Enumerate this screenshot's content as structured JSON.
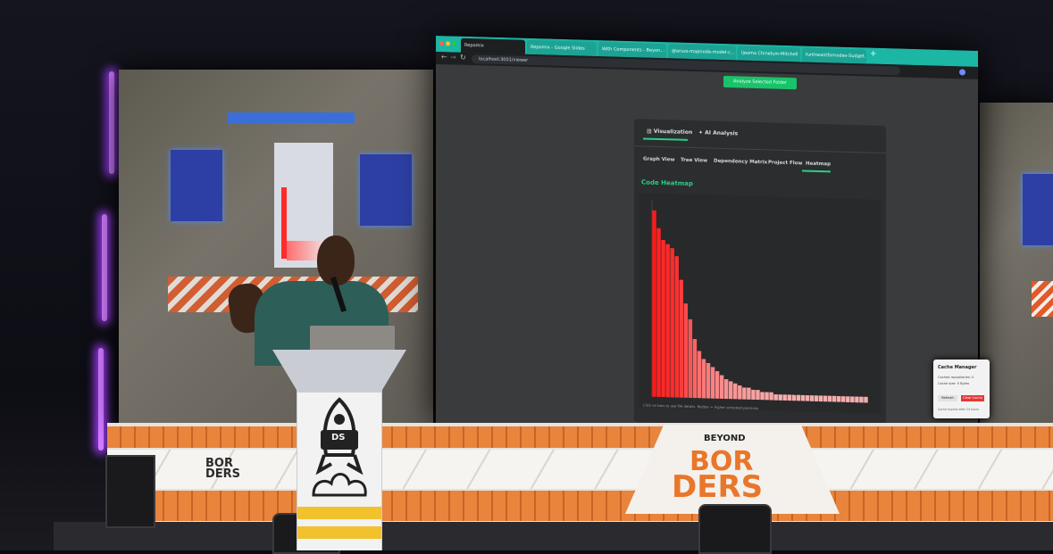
{
  "browser": {
    "tabs": [
      "Repomix",
      "Repomix - Google Slides",
      "With Components - Beyon…",
      "@aruss-mapnode-model-c…",
      "Ijeoma Chinelum-Mitchell",
      "furthwantfornodes-Sudget…"
    ],
    "url": "localhost:3001/viewer"
  },
  "app": {
    "analyze_button": "Analyze Selected Folder",
    "main_tabs": [
      "Visualization",
      "AI Analysis"
    ],
    "sub_tabs": [
      "Graph View",
      "Tree View",
      "Dependency Matrix",
      "Project Flow",
      "Heatmap"
    ],
    "heatmap_title": "Code Heatmap",
    "chart_note": "Click on bars to see file details. Redder = higher complexity/activity"
  },
  "cache_manager": {
    "title": "Cache Manager",
    "line1": "Cached repositories: 0",
    "line2": "Cache size: 0 Bytes",
    "refresh": "Refresh",
    "clear": "Clear Cache",
    "note": "Cache expires after 24 hours"
  },
  "stage": {
    "logo_top": "BEYOND",
    "logo_mid": "BOR",
    "logo_bot": "DERS",
    "podium_logo": "DS"
  },
  "chart_data": {
    "type": "bar",
    "values": [
      95,
      86,
      80,
      78,
      76,
      72,
      60,
      48,
      40,
      30,
      24,
      20,
      18,
      16,
      14,
      12,
      10,
      9,
      8,
      7,
      6,
      6,
      5,
      5,
      4,
      4,
      4,
      3,
      3,
      3,
      3,
      3,
      3,
      3,
      3,
      3,
      3,
      3,
      3,
      3,
      3,
      3,
      3,
      3,
      3,
      3,
      3,
      3
    ],
    "ylim": [
      0,
      100
    ],
    "colors": {
      "hot": "#ff1a1a",
      "cool": "#f4d4d4"
    }
  }
}
